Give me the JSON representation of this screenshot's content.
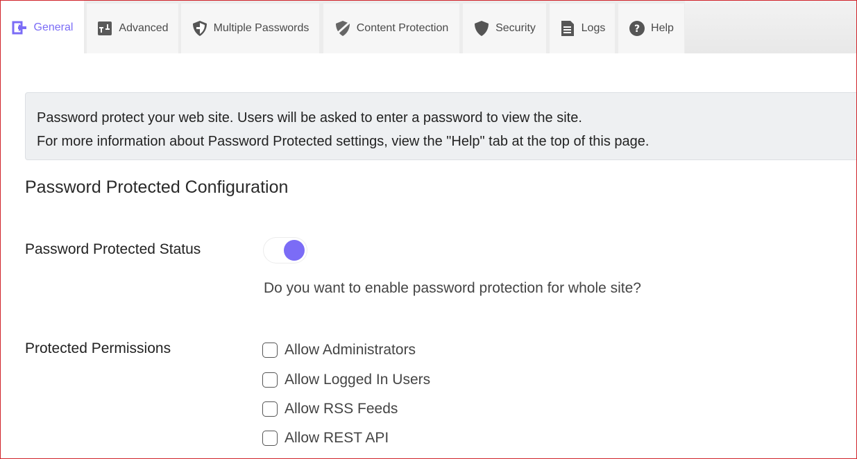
{
  "tabs": [
    {
      "label": "General",
      "icon": "arrow-right-box-icon",
      "active": true
    },
    {
      "label": "Advanced",
      "icon": "advanced-sliders-icon",
      "active": false
    },
    {
      "label": "Multiple Passwords",
      "icon": "shield-half-icon",
      "active": false
    },
    {
      "label": "Content Protection",
      "icon": "shield-slash-icon",
      "active": false
    },
    {
      "label": "Security",
      "icon": "shield-icon",
      "active": false
    },
    {
      "label": "Logs",
      "icon": "document-icon",
      "active": false
    },
    {
      "label": "Help",
      "icon": "question-circle-icon",
      "active": false
    }
  ],
  "notice": {
    "line1": "Password protect your web site. Users will be asked to enter a password to view the site.",
    "line2": "For more information about Password Protected settings, view the \"Help\" tab at the top of this page."
  },
  "section": {
    "title": "Password Protected Configuration"
  },
  "status": {
    "label": "Password Protected Status",
    "enabled": true,
    "description": "Do you want to enable password protection for whole site?"
  },
  "permissions": {
    "label": "Protected Permissions",
    "options": [
      {
        "label": "Allow Administrators",
        "checked": false
      },
      {
        "label": "Allow Logged In Users",
        "checked": false
      },
      {
        "label": "Allow RSS Feeds",
        "checked": false
      },
      {
        "label": "Allow REST API",
        "checked": false
      }
    ]
  },
  "colors": {
    "accent": "#7b6cf6",
    "frame_border": "#d0232a",
    "tab_bg": "#f6f6f6",
    "notice_bg": "#eef0f2"
  }
}
